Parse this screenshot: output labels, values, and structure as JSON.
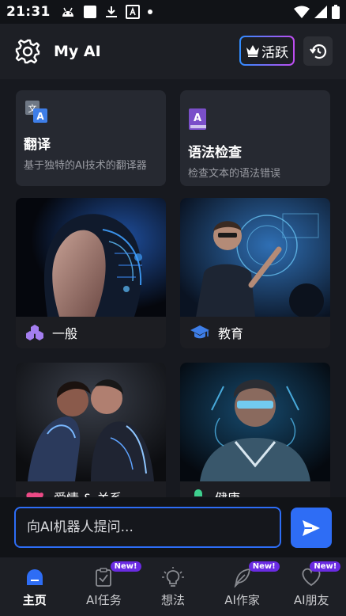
{
  "status_bar": {
    "time": "21:31"
  },
  "app_bar": {
    "title": "My AI",
    "vip_label": "活跃"
  },
  "tools": [
    {
      "title": "翻译",
      "description": "基于独特的AI技术的翻译器"
    },
    {
      "title": "语法检查",
      "description": "检查文本的语法错误"
    }
  ],
  "categories": [
    {
      "label": "一般"
    },
    {
      "label": "教育"
    },
    {
      "label": "爱情 & 关系"
    },
    {
      "label": "健康"
    }
  ],
  "input": {
    "placeholder": "向AI机器人提问..."
  },
  "bottom_nav": [
    {
      "label": "主页",
      "badge": ""
    },
    {
      "label": "AI任务",
      "badge": "New!"
    },
    {
      "label": "想法",
      "badge": ""
    },
    {
      "label": "AI作家",
      "badge": "New!"
    },
    {
      "label": "AI朋友",
      "badge": "New!"
    }
  ],
  "colors": {
    "accent": "#2e6df5",
    "badge": "#6a2be2",
    "card": "#262931",
    "background": "#17191f"
  }
}
